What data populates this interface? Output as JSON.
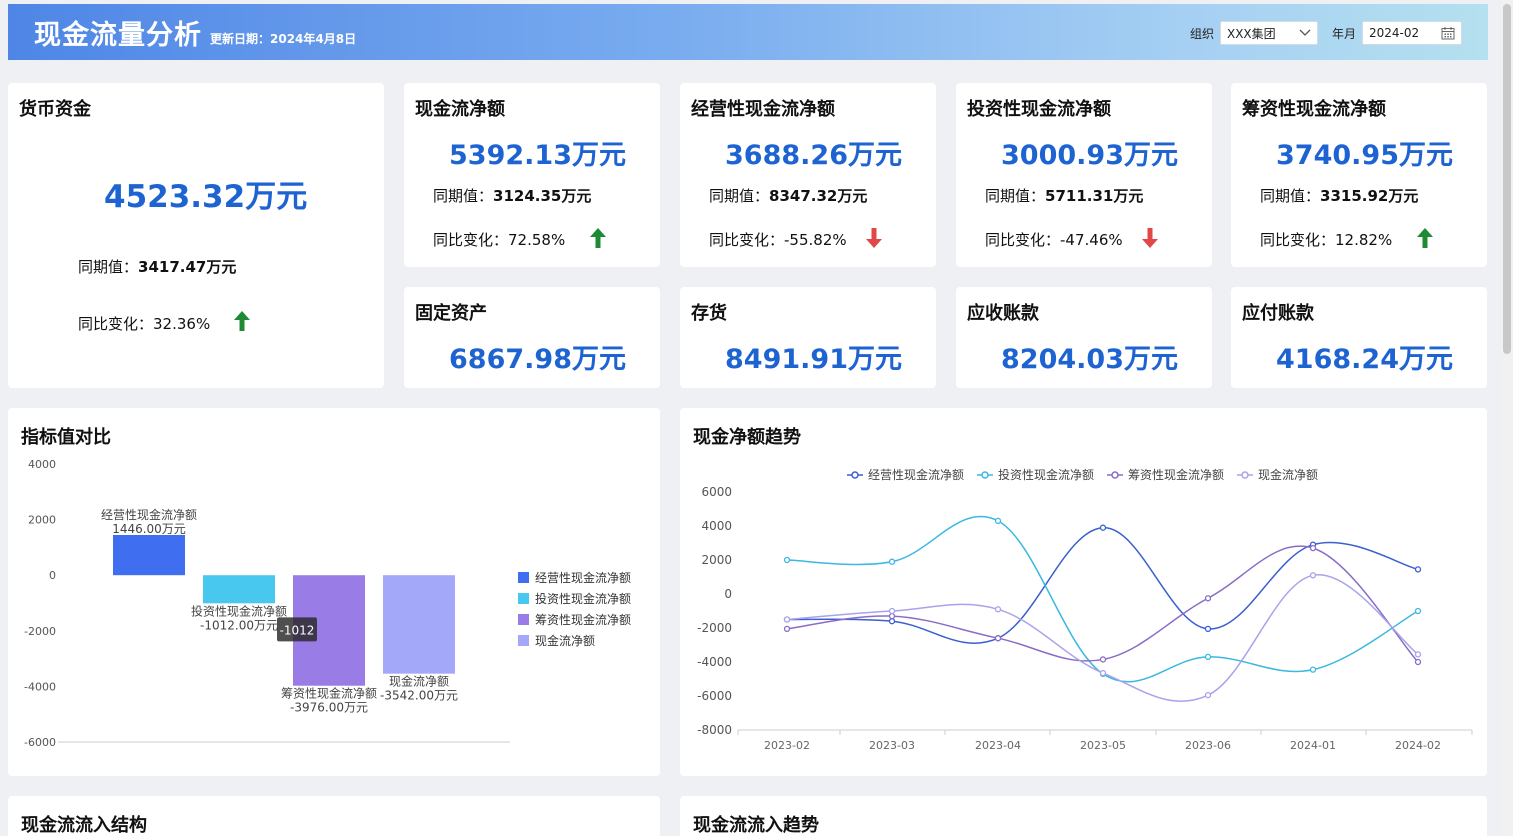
{
  "header": {
    "title": "现金流量分析",
    "update_date": "更新日期：2024年4月8日",
    "org_label": "组织",
    "org_value": "XXX集团",
    "month_label": "年月",
    "month_value": "2024-02"
  },
  "kpi": {
    "money_funds": {
      "title": "货币资金",
      "value": "4523.32万元",
      "prev_label": "同期值：",
      "prev_value": "3417.47万元",
      "change_label": "同比变化：",
      "change_value": "32.36%",
      "trend": "up"
    },
    "net_cash": {
      "title": "现金流净额",
      "value": "5392.13万元",
      "prev_label": "同期值：",
      "prev_value": "3124.35万元",
      "change_label": "同比变化：",
      "change_value": "72.58%",
      "trend": "up"
    },
    "operating": {
      "title": "经营性现金流净额",
      "value": "3688.26万元",
      "prev_label": "同期值：",
      "prev_value": "8347.32万元",
      "change_label": "同比变化：",
      "change_value": "-55.82%",
      "trend": "down"
    },
    "investing": {
      "title": "投资性现金流净额",
      "value": "3000.93万元",
      "prev_label": "同期值：",
      "prev_value": "5711.31万元",
      "change_label": "同比变化：",
      "change_value": "-47.46%",
      "trend": "down"
    },
    "financing": {
      "title": "筹资性现金流净额",
      "value": "3740.95万元",
      "prev_label": "同期值：",
      "prev_value": "3315.92万元",
      "change_label": "同比变化：",
      "change_value": "12.82%",
      "trend": "up"
    },
    "fixed_assets": {
      "title": "固定资产",
      "value": "6867.98万元"
    },
    "inventory": {
      "title": "存货",
      "value": "8491.91万元"
    },
    "receivables": {
      "title": "应收账款",
      "value": "8204.03万元"
    },
    "payables": {
      "title": "应付账款",
      "value": "4168.24万元"
    }
  },
  "panels": {
    "comparison_title": "指标值对比",
    "trend_title": "现金净额趋势",
    "inflow_structure_title": "现金流流入结构",
    "inflow_trend_title": "现金流流入趋势"
  },
  "colors": {
    "up": "#1e8a34",
    "down": "#e04848",
    "value_blue": "#1e63d2"
  },
  "chart_data": [
    {
      "type": "bar",
      "categories": [
        "经营性现金流净额",
        "投资性现金流净额",
        "筹资性现金流净额",
        "现金流净额"
      ],
      "values": [
        1446,
        -1012,
        -3976,
        -3542
      ],
      "data_labels": [
        "1446.00万元",
        "-1012.00万元",
        "-3976.00万元",
        "-3542.00万元"
      ],
      "ylim": [
        -6000,
        4000
      ],
      "yticks": [
        4000,
        2000,
        0,
        -2000,
        -4000,
        -6000
      ],
      "series_colors": [
        "#3f6ff0",
        "#48c8ef",
        "#9a7ce6",
        "#a3a8f8"
      ],
      "legend": [
        "经营性现金流净额",
        "投资性现金流净额",
        "筹资性现金流净额",
        "现金流净额"
      ],
      "legend_position": "right",
      "tooltip": {
        "category": "投资性现金流净额",
        "text": "-1012"
      }
    },
    {
      "type": "line",
      "x": [
        "2023-02",
        "2023-03",
        "2023-04",
        "2023-05",
        "2023-06",
        "2024-01",
        "2024-02"
      ],
      "ylim": [
        -8000,
        6000
      ],
      "yticks": [
        6000,
        4000,
        2000,
        0,
        -2000,
        -4000,
        -6000,
        -8000
      ],
      "legend_position": "top",
      "series": [
        {
          "name": "经营性现金流净额",
          "color": "#3a5fd0",
          "values": [
            -1500,
            -1600,
            -2600,
            3900,
            -2050,
            2900,
            1450
          ]
        },
        {
          "name": "投资性现金流净额",
          "color": "#3ab8e0",
          "values": [
            2000,
            1900,
            4300,
            -4700,
            -3700,
            -4450,
            -1000
          ]
        },
        {
          "name": "筹资性现金流净额",
          "color": "#8a6cc8",
          "values": [
            -2050,
            -1300,
            -2600,
            -3850,
            -250,
            2700,
            -4000
          ]
        },
        {
          "name": "现金流净额",
          "color": "#a8a3ea",
          "values": [
            -1500,
            -1000,
            -900,
            -4650,
            -5950,
            1100,
            -3550
          ]
        }
      ]
    }
  ]
}
